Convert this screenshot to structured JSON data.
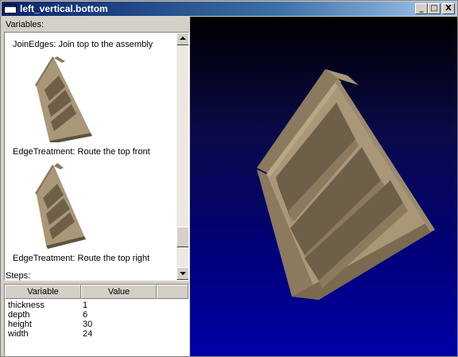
{
  "window": {
    "title": "left_vertical.bottom",
    "minimize_glyph": "_",
    "maximize_glyph": "□",
    "close_glyph": "X"
  },
  "variables_panel": {
    "label": "Variables:",
    "items": [
      {
        "label": "JoinEdges: Join top to the assembly",
        "thumbnail": "shelf-thumbnail"
      },
      {
        "label": "EdgeTreatment: Route the top front",
        "thumbnail": "shelf-thumbnail"
      },
      {
        "label": "EdgeTreatment: Route the top right",
        "thumbnail": "shelf-thumbnail"
      }
    ]
  },
  "steps_panel": {
    "label": "Steps:",
    "columns": [
      "Variable",
      "Value",
      ""
    ],
    "rows": [
      {
        "variable": "thickness",
        "value": "1"
      },
      {
        "variable": "depth",
        "value": "6"
      },
      {
        "variable": "height",
        "value": "30"
      },
      {
        "variable": "width",
        "value": "24"
      }
    ]
  },
  "viewport": {
    "model": "bookshelf-3d-model",
    "colors": {
      "background_top": "#000000",
      "background_bottom": "#0000a8",
      "wood_light": "#a99778",
      "wood_mid": "#8b7a5e",
      "wood_dark": "#5e5240"
    }
  }
}
